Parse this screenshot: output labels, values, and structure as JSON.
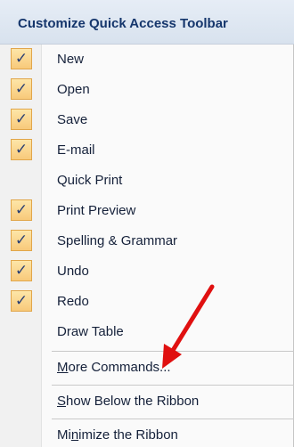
{
  "menu": {
    "title": "Customize Quick Access Toolbar",
    "items": [
      {
        "label": "New",
        "checked": true
      },
      {
        "label": "Open",
        "checked": true
      },
      {
        "label": "Save",
        "checked": true
      },
      {
        "label": "E-mail",
        "checked": true
      },
      {
        "label": "Quick Print",
        "checked": false
      },
      {
        "label": "Print Preview",
        "checked": true
      },
      {
        "label": "Spelling & Grammar",
        "checked": true
      },
      {
        "label": "Undo",
        "checked": true
      },
      {
        "label": "Redo",
        "checked": true
      },
      {
        "label": "Draw Table",
        "checked": false
      }
    ],
    "more_commands": {
      "pre": "",
      "mnemonic": "M",
      "post": "ore Commands..."
    },
    "show_below": {
      "pre": "",
      "mnemonic": "S",
      "post": "how Below the Ribbon"
    },
    "minimize": {
      "pre": "Mi",
      "mnemonic": "n",
      "post": "imize the Ribbon"
    },
    "check_glyph": "✓",
    "annotation_arrow_color": "#e01010"
  }
}
